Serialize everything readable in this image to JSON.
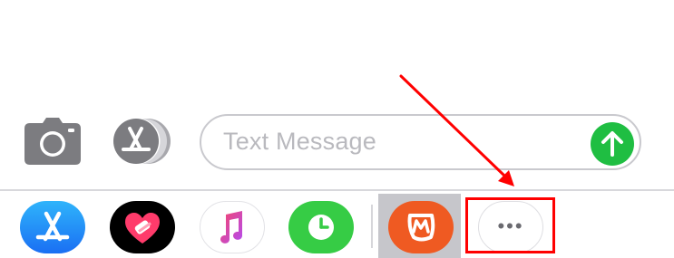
{
  "compose": {
    "camera_icon": "camera-icon",
    "apps_icon": "app-store-icon",
    "message_placeholder": "Text Message",
    "send_icon": "arrow-up-icon",
    "send_color": "#1fbe42"
  },
  "drawer": {
    "apps": [
      {
        "name": "App Store",
        "icon": "app-store-icon",
        "color": "#1a8cf7"
      },
      {
        "name": "Digital Touch",
        "icon": "heart-icon",
        "color": "#000000"
      },
      {
        "name": "Music",
        "icon": "music-note-icon",
        "color": "#ffffff"
      },
      {
        "name": "Activity",
        "icon": "clock-icon",
        "color": "#36cc45"
      },
      {
        "name": "Mango TV",
        "icon": "mango-tv-icon",
        "color": "#ef5a22",
        "selected": true
      },
      {
        "name": "More",
        "icon": "more-dots-icon",
        "label": "•••"
      }
    ]
  },
  "annotations": {
    "highlight_color": "#ff0000",
    "arrow_color": "#ff0000"
  }
}
